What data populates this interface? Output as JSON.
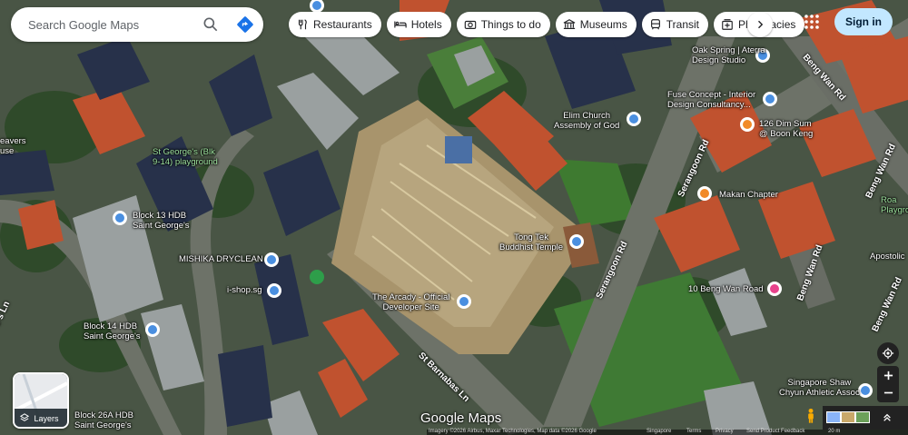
{
  "search": {
    "placeholder": "Search Google Maps"
  },
  "chips": [
    {
      "label": "Restaurants",
      "icon": "restaurant-icon"
    },
    {
      "label": "Hotels",
      "icon": "hotel-icon"
    },
    {
      "label": "Things to do",
      "icon": "camera-icon"
    },
    {
      "label": "Museums",
      "icon": "museum-icon"
    },
    {
      "label": "Transit",
      "icon": "transit-icon"
    },
    {
      "label": "Pharmacies",
      "icon": "pharmacy-icon"
    }
  ],
  "header": {
    "signin_label": "Sign in"
  },
  "places": {
    "oak_spring": "Oak Spring | Aterra\nDesign Studio",
    "fuse_concept": "Fuse Concept - Interior\nDesign Consultancy...",
    "dim_sum": "126 Dim Sum\n@ Boon Keng",
    "elim_church": "Elim Church\nAssembly of God",
    "makan_chapter": "Makan Chapter",
    "tong_tek": "Tong Tek\nBuddhist Temple",
    "beng_wan_10": "10 Beng Wan Road",
    "apostolic": "Apostolic",
    "roa_playground": "Roa\nPlaygro",
    "arcady": "The Arcady - Official\nDeveloper Site",
    "block13": "Block 13 HDB\nSaint George's",
    "mishika": "MISHIKA DRYCLEAN",
    "ishop": "i-shop.sg",
    "block14": "Block 14 HDB\nSaint George's",
    "block26a": "Block 26A HDB\nSaint George's",
    "stgeorges_playground": "St George's (Blk\n9-14) playground",
    "weavers": "eavers\nuse",
    "singapore_shaw": "Singapore Shaw\nChyun Athletic Assoc"
  },
  "roads": {
    "beng_wan_1": "Beng Wan Rd",
    "beng_wan_2": "Beng Wan Rd",
    "beng_wan_3": "Beng Wan Rd",
    "beng_wan_4": "Beng Wan Rd",
    "serangoon_1": "Serangoon Rd",
    "serangoon_2": "Serangoon Rd",
    "st_barnabas": "St Barnabas Ln",
    "georges_ln": "e's Ln"
  },
  "layers": {
    "label": "Layers"
  },
  "footer": {
    "logo": "Google Maps",
    "imagery": "Imagery ©2026 Airbus, Maxar Technologies, Map data ©2026 Google",
    "singapore": "Singapore",
    "terms": "Terms",
    "privacy": "Privacy",
    "feedback": "Send Product Feedback",
    "scale": "20 m"
  },
  "colors": {
    "signin_bg": "#c2e7ff",
    "pin_blue": "#4a8fe0",
    "pin_orange": "#f18a28",
    "pin_pink": "#e8438c"
  }
}
